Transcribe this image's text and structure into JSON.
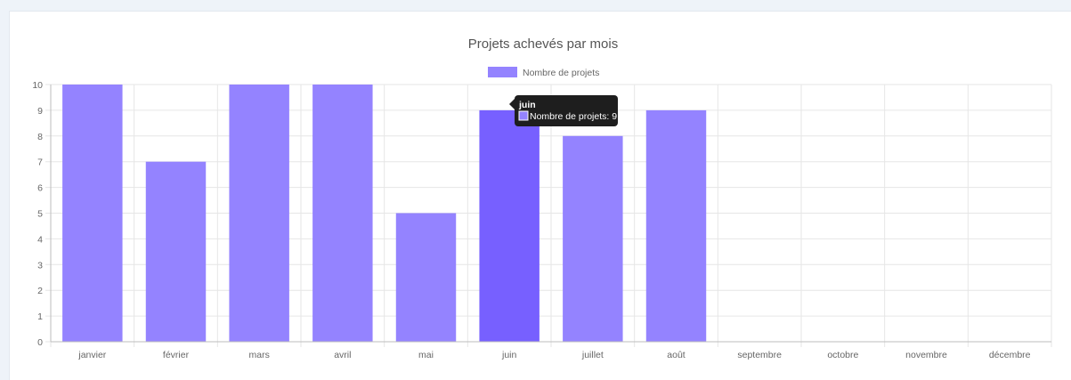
{
  "chart_data": {
    "type": "bar",
    "title": "Projets achevés par mois",
    "categories": [
      "janvier",
      "février",
      "mars",
      "avril",
      "mai",
      "juin",
      "juillet",
      "août",
      "septembre",
      "octobre",
      "novembre",
      "décembre"
    ],
    "series": [
      {
        "name": "Nombre de projets",
        "values": [
          10,
          7,
          10,
          10,
          5,
          9,
          8,
          9,
          null,
          null,
          null,
          null
        ]
      }
    ],
    "ylim": [
      0,
      10
    ],
    "yticks": [
      0,
      1,
      2,
      3,
      4,
      5,
      6,
      7,
      8,
      9,
      10
    ],
    "grid": true,
    "legend": "top-center",
    "colors": {
      "bar": "#9483ff",
      "bar_highlight": "#7760ff",
      "grid": "#e6e6e6",
      "axis": "#bdbdbd",
      "tooltip_bg": "#1e1e1e"
    },
    "tooltip": {
      "title": "juin",
      "label": "Nombre de projets: 9",
      "category_index": 5
    }
  }
}
